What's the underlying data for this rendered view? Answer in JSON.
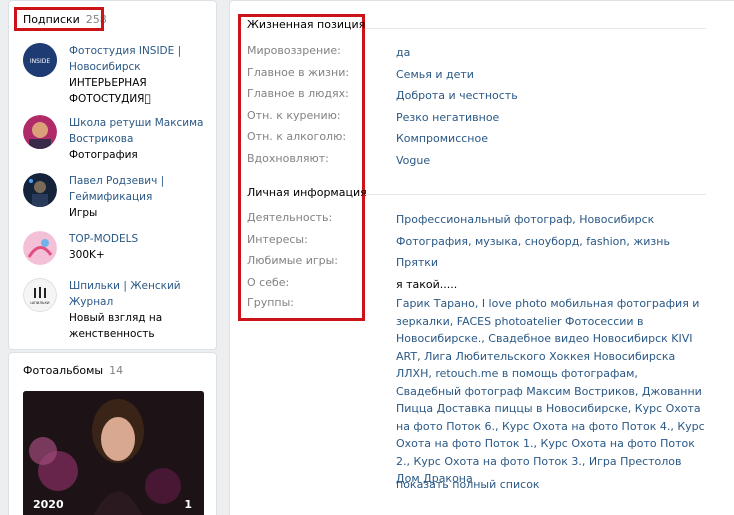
{
  "subscriptions": {
    "title": "Подписки",
    "count": "258",
    "items": [
      {
        "name": "Фотостудия INSIDE | Новосибирск",
        "desc": "ИНТЕРЬЕРНАЯ ФОТОСТУДИЯ⃞",
        "avatar_text": "INSIDE"
      },
      {
        "name": "Школа ретуши Максима Вострикова",
        "desc": "Фотография",
        "avatar_text": ""
      },
      {
        "name": "Павел Родзевич | Геймификация",
        "desc": "Игры",
        "avatar_text": ""
      },
      {
        "name": "TOP-MODELS",
        "desc": "300K+",
        "avatar_text": ""
      },
      {
        "name": "Шпильки | Женский Журнал",
        "desc": "Новый взгляд на женственность",
        "avatar_text": "ШПИЛЬКИ"
      }
    ]
  },
  "albums": {
    "title": "Фотоальбомы",
    "count": "14",
    "cover_label": "2020",
    "cover_count": "1"
  },
  "life_position": {
    "title": "Жизненная позиция",
    "rows": [
      {
        "label": "Мировоззрение:",
        "value": "да"
      },
      {
        "label": "Главное в жизни:",
        "value": "Семья и дети"
      },
      {
        "label": "Главное в людях:",
        "value": "Доброта и честность"
      },
      {
        "label": "Отн. к курению:",
        "value": "Резко негативное"
      },
      {
        "label": "Отн. к алкоголю:",
        "value": "Компромиссное"
      },
      {
        "label": "Вдохновляют:",
        "value": "Vogue"
      }
    ]
  },
  "personal_info": {
    "title": "Личная информация",
    "rows": [
      {
        "label": "Деятельность:",
        "value": "Профессиональный фотограф, Новосибирск"
      },
      {
        "label": "Интересы:",
        "value": "Фотография, музыка, сноуборд, fashion, жизнь"
      },
      {
        "label": "Любимые игры:",
        "value": "Прятки"
      },
      {
        "label": "О себе:",
        "value": "я такой....."
      },
      {
        "label": "Группы:",
        "value": "Гарик Тарано, I love photo мобильная фотография и зеркалки, FACES photoatelier Фотосессии в Новосибирске., Свадебное видео Новосибирск KIVI ART, Лига Любительского Хоккея Новосибирска ЛЛХН, retouch.me в помощь фотографам, Свадебный фотограф Максим Востриков, Джованни Пицца Доставка пиццы в Новосибирске, Курс Охота на фото Поток 6., Курс Охота на фото Поток 4., Курс Охота на фото Поток 1., Курс Охота на фото Поток 2., Курс Охота на фото Поток 3., Игра Престолов Дом Дракона"
      }
    ],
    "show_full": "показать полный список"
  },
  "colors": {
    "link": "#2a5885",
    "label": "#828282",
    "highlight": "#cc1418",
    "background": "#edeef0"
  }
}
